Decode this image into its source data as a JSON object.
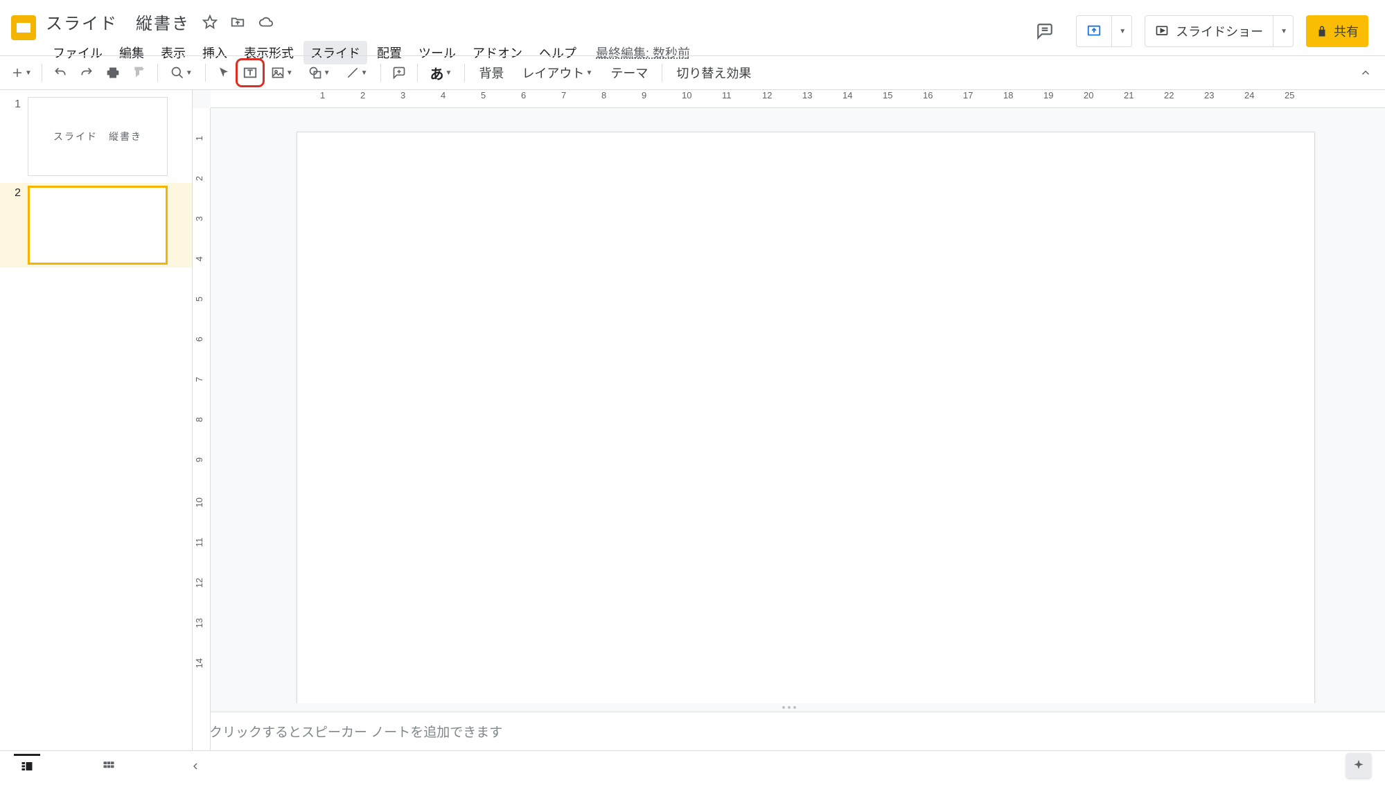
{
  "doc": {
    "title": "スライド　縦書き",
    "last_edit": "最終編集: 数秒前"
  },
  "menus": {
    "file": "ファイル",
    "edit": "編集",
    "view": "表示",
    "insert": "挿入",
    "format": "表示形式",
    "slide": "スライド",
    "arrange": "配置",
    "tools": "ツール",
    "addons": "アドオン",
    "help": "ヘルプ"
  },
  "header_right": {
    "slideshow": "スライドショー",
    "share": "共有"
  },
  "toolbar": {
    "background": "背景",
    "layout": "レイアウト",
    "theme": "テーマ",
    "transition": "切り替え効果",
    "ime": "あ"
  },
  "thumbnails": [
    {
      "num": "1",
      "text": "スライド　縦書き"
    },
    {
      "num": "2",
      "text": ""
    }
  ],
  "selected_thumb_index": 1,
  "ruler_h": [
    "1",
    "2",
    "3",
    "4",
    "5",
    "6",
    "7",
    "8",
    "9",
    "10",
    "11",
    "12",
    "13",
    "14",
    "15",
    "16",
    "17",
    "18",
    "19",
    "20",
    "21",
    "22",
    "23",
    "24",
    "25"
  ],
  "ruler_v": [
    "1",
    "2",
    "3",
    "4",
    "5",
    "6",
    "7",
    "8",
    "9",
    "10",
    "11",
    "12",
    "13",
    "14"
  ],
  "notes_placeholder": "クリックするとスピーカー ノートを追加できます"
}
